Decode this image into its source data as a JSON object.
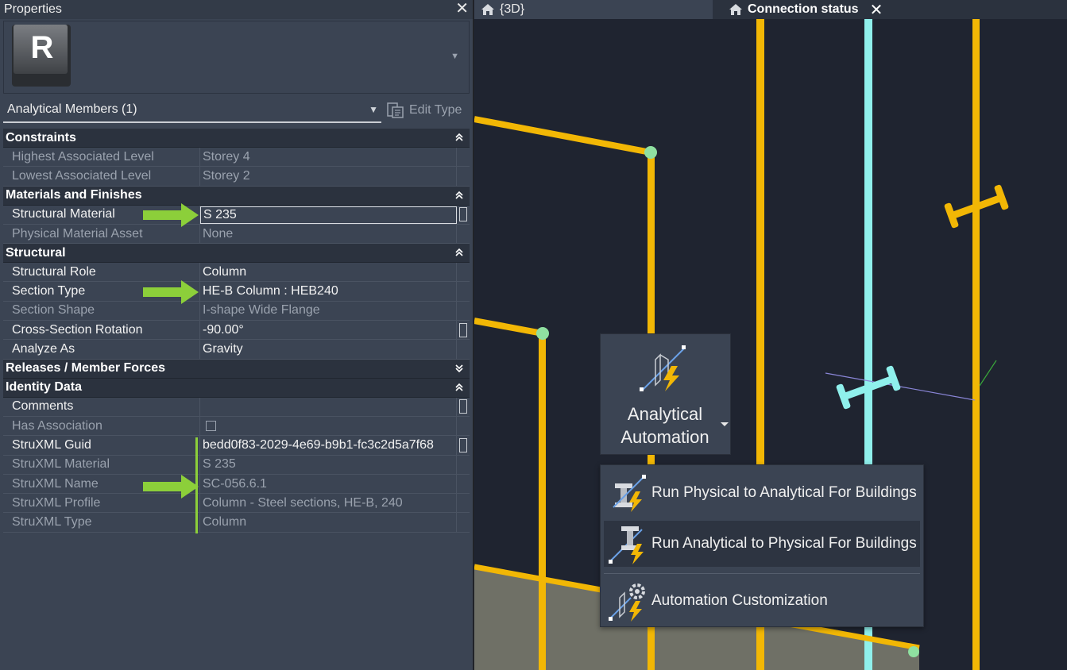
{
  "properties_panel": {
    "title": "Properties",
    "close_glyph": "✕",
    "type_selector": {
      "logo_letter": "R"
    },
    "category": "Analytical Members (1)",
    "edit_type_label": "Edit Type",
    "sections": {
      "constraints": "Constraints",
      "materials": "Materials and Finishes",
      "structural": "Structural",
      "releases": "Releases / Member Forces",
      "identity": "Identity Data"
    },
    "rows": {
      "highest_level": {
        "label": "Highest Associated Level",
        "value": "Storey 4"
      },
      "lowest_level": {
        "label": "Lowest Associated Level",
        "value": "Storey 2"
      },
      "structural_material": {
        "label": "Structural Material",
        "value": "S 235"
      },
      "physical_asset": {
        "label": "Physical Material Asset",
        "value": "None"
      },
      "structural_role": {
        "label": "Structural Role",
        "value": "Column"
      },
      "section_type": {
        "label": "Section Type",
        "value": "HE-B Column : HEB240"
      },
      "section_shape": {
        "label": "Section Shape",
        "value": "I-shape Wide Flange"
      },
      "rotation": {
        "label": "Cross-Section Rotation",
        "value": "-90.00°"
      },
      "analyze_as": {
        "label": "Analyze As",
        "value": "Gravity"
      },
      "comments": {
        "label": "Comments",
        "value": ""
      },
      "has_association": {
        "label": "Has Association",
        "value": ""
      },
      "struxml_guid": {
        "label": "StruXML Guid",
        "value": "bedd0f83-2029-4e69-b9b1-fc3c2d5a7f68"
      },
      "struxml_material": {
        "label": "StruXML Material",
        "value": "S 235"
      },
      "struxml_name": {
        "label": "StruXML Name",
        "value": "SC-056.6.1"
      },
      "struxml_profile": {
        "label": "StruXML Profile",
        "value": "Column - Steel sections, HE-B, 240"
      },
      "struxml_type": {
        "label": "StruXML Type",
        "value": "Column"
      }
    }
  },
  "viewport": {
    "tabs": [
      {
        "label": "{3D}",
        "icon": "home-icon",
        "active": false
      },
      {
        "label": "Connection status",
        "icon": "home-icon",
        "active": true
      }
    ],
    "tab_close_glyph": "✕"
  },
  "automation": {
    "button_label_line1": "Analytical",
    "button_label_line2": "Automation",
    "menu": [
      {
        "label": "Run Physical to Analytical For Buildings",
        "icon": "physical-to-analytical-icon"
      },
      {
        "label": "Run Analytical to Physical For Buildings",
        "icon": "analytical-to-physical-icon"
      },
      {
        "label": "Automation Customization",
        "icon": "automation-customization-icon"
      }
    ]
  },
  "colors": {
    "panel_bg": "#3b4453",
    "section_bg": "#2b323e",
    "viewport_bg": "#1f2430",
    "member_yellow": "#f2b705",
    "member_cyan": "#8ff0ec",
    "node_green": "#8fe0a0",
    "annotation_arrow": "#8ccf3a",
    "floor": "#6f7066"
  }
}
